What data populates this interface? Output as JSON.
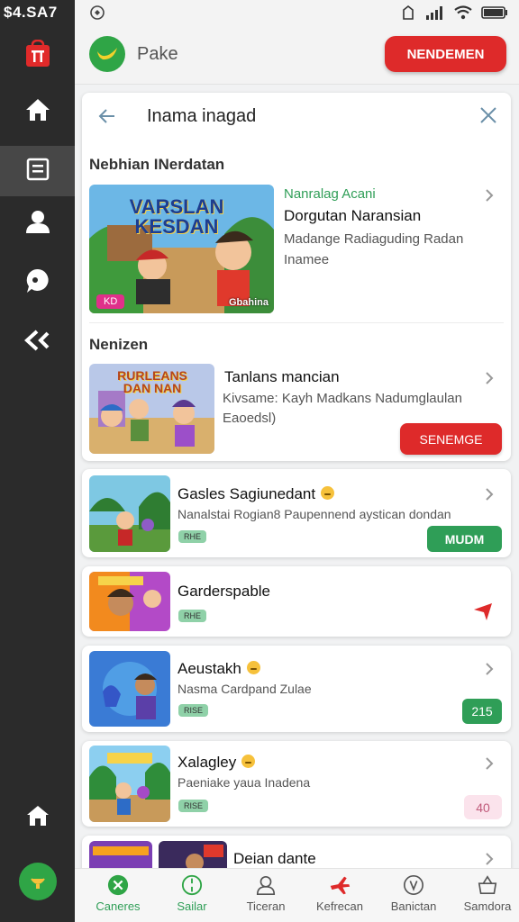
{
  "status": {
    "time": "$4.SA7",
    "icons": [
      "notification-icon",
      "battery-saver-icon",
      "signal-icon",
      "wifi-icon",
      "battery-icon"
    ]
  },
  "rail": {
    "items": [
      "store-icon",
      "home-icon",
      "document-icon",
      "profile-icon",
      "chat-icon",
      "share-icon",
      "home-icon",
      "bag-icon"
    ],
    "active": 2
  },
  "header": {
    "app_name": "Pake",
    "action_label": "NENDEMEN"
  },
  "search": {
    "query": "Inama inagad"
  },
  "sections": {
    "first_title": "Nebhian INerdatan",
    "second_title": "Nenizen"
  },
  "featured": {
    "thumb_title": "VARSLAN KESDAN",
    "thumb_badge": "KD",
    "thumb_corner": "Gbahina",
    "category": "Nanralag Acani",
    "title": "Dorgutan Naransian",
    "description": "Madange Radiaguding Radan Inamee"
  },
  "second": {
    "thumb_title": "RURLEANS DAN NAN",
    "title": "Tanlans mancian",
    "description": "Kivsame: Kayh Madkans Nadumglaulan Eaoedsl)",
    "button_label": "SENEMGE"
  },
  "cards": [
    {
      "title": "Gasles Sagiunedant",
      "subtitle": "Nanalstai Rogian8 Paupennend aystican dondan",
      "badge": "RHE",
      "button": "MUDM",
      "button_style": "green",
      "emoji": true
    },
    {
      "title": "Garderspable",
      "subtitle": "",
      "badge": "RHE",
      "button": "",
      "button_style": "arrow",
      "emoji": false
    },
    {
      "title": "Aeustakh",
      "subtitle": "Nasma Cardpand Zulae",
      "badge": "RISE",
      "button": "215",
      "button_style": "green",
      "emoji": true
    },
    {
      "title": "Xalagley",
      "subtitle": "Paeniake yaua Inadena",
      "badge": "RISE",
      "button": "40",
      "button_style": "pink",
      "emoji": true
    },
    {
      "title": "Deian dante",
      "subtitle": "",
      "badge": "",
      "button": "",
      "button_style": "none",
      "emoji": false
    }
  ],
  "bottom_nav": [
    {
      "label": "Caneres",
      "icon": "close-circle-icon",
      "active": true
    },
    {
      "label": "Sailar",
      "icon": "compass-icon",
      "active": false
    },
    {
      "label": "Ticeran",
      "icon": "user-outline-icon",
      "active": false
    },
    {
      "label": "Kefrecan",
      "icon": "plane-icon",
      "active": false
    },
    {
      "label": "Banictan",
      "icon": "badge-icon",
      "active": false
    },
    {
      "label": "Samdora",
      "icon": "basket-icon",
      "active": false
    }
  ],
  "colors": {
    "accent_red": "#de2a2a",
    "accent_green": "#2fa546",
    "rail_bg": "#2b2b2b"
  }
}
